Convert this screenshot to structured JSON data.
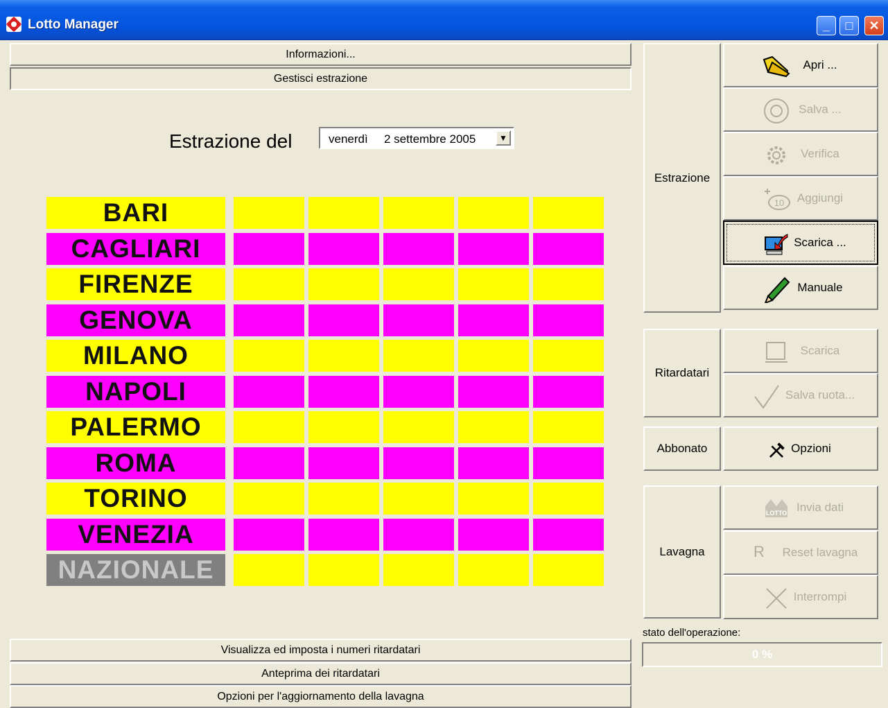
{
  "window": {
    "title": "Lotto Manager"
  },
  "top_bars": {
    "info": "Informazioni...",
    "manage": "Gestisci estrazione"
  },
  "draw": {
    "label": "Estrazione del",
    "date_day": "venerdì",
    "date_value": "2 settembre 2005",
    "cities": [
      "BARI",
      "CAGLIARI",
      "FIRENZE",
      "GENOVA",
      "MILANO",
      "NAPOLI",
      "PALERMO",
      "ROMA",
      "TORINO",
      "VENEZIA",
      "NAZIONALE"
    ]
  },
  "bottom_bars": {
    "late_numbers": "Visualizza ed imposta i numeri ritardatari",
    "preview": "Anteprima dei ritardatari",
    "board_options": "Opzioni per l'aggiornamento della lavagna"
  },
  "groups": {
    "estrazione": "Estrazione",
    "ritardatari": "Ritardatari",
    "abbonato": "Abbonato",
    "lavagna": "Lavagna"
  },
  "actions": {
    "open": "Apri ...",
    "save": "Salva ...",
    "verify": "Verifica",
    "add": "Aggiungi",
    "download": "Scarica ...",
    "manual": "Manuale",
    "late_download": "Scarica",
    "save_wheel": "Salva ruota...",
    "options": "Opzioni",
    "send_data": "Invia dati",
    "reset_board": "Reset lavagna",
    "interrupt": "Interrompi",
    "add_icon_text": "10",
    "lotto_icon_text": "LOTTO",
    "reset_icon_text": "R"
  },
  "status": {
    "label": "stato dell'operazione:",
    "progress": "0 %"
  },
  "colors": {
    "yellow": "#ffff00",
    "magenta": "#ff00ff",
    "gray": "#808080"
  }
}
